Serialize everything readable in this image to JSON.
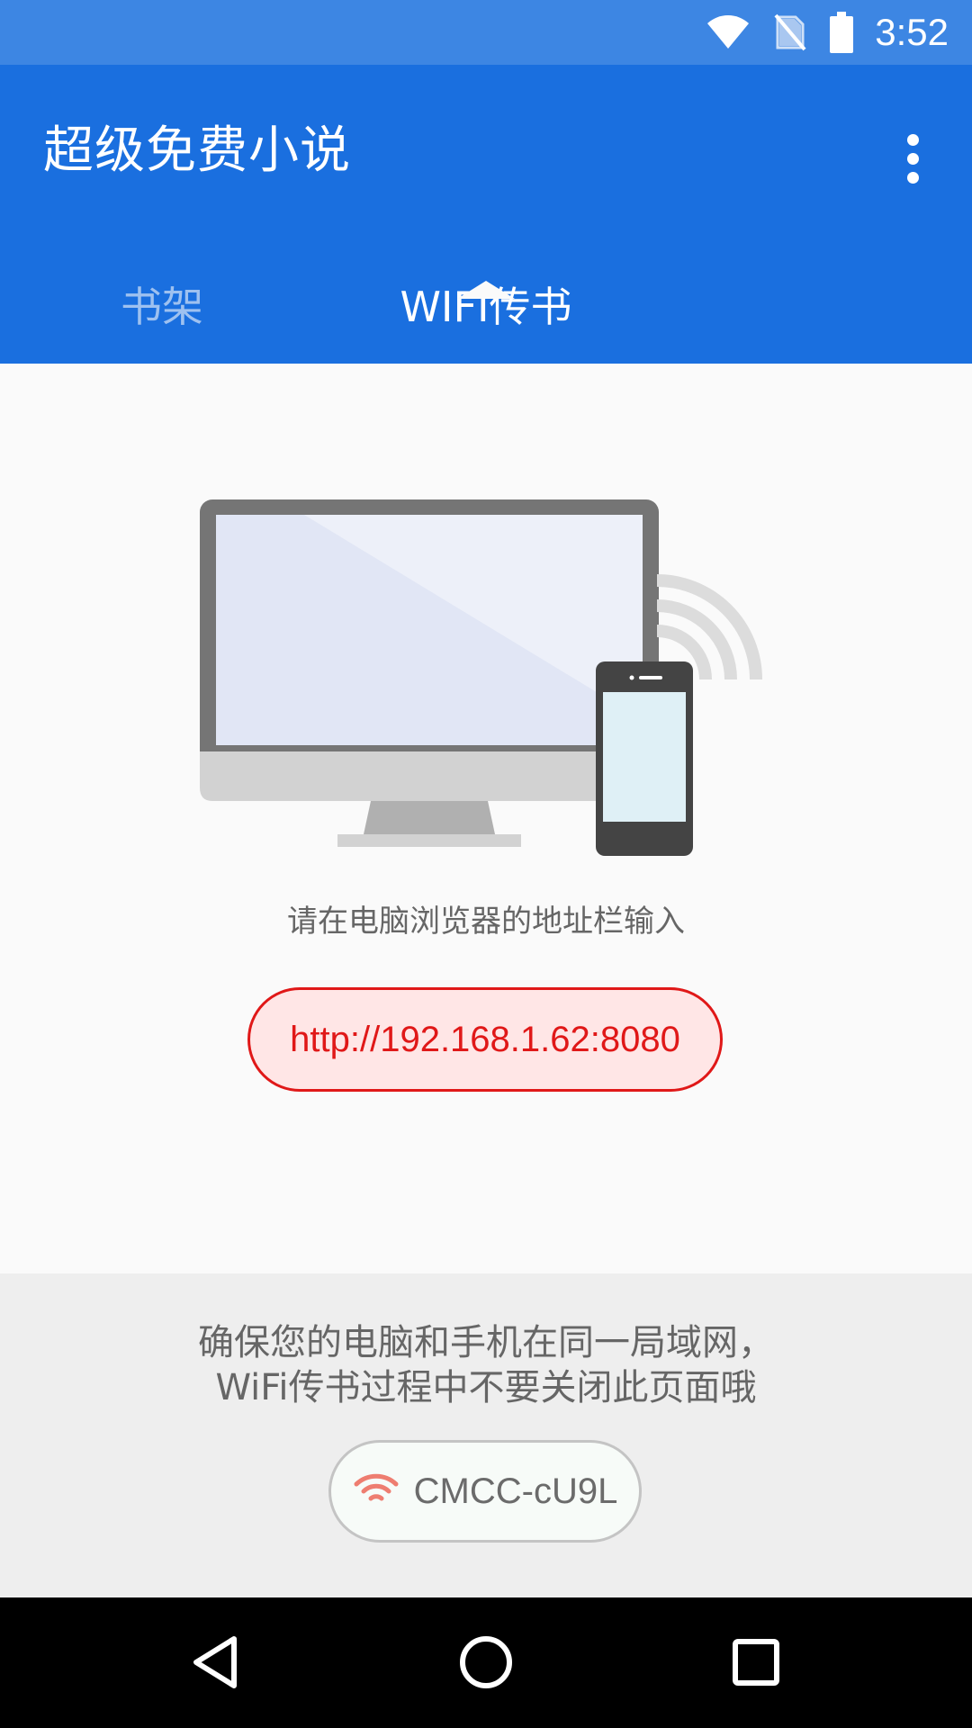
{
  "status_bar": {
    "time": "3:52",
    "icons": [
      "wifi-icon",
      "no-sim-icon",
      "battery-icon"
    ]
  },
  "app_bar": {
    "title": "超级免费小说",
    "overflow_icon": "more-vert-icon"
  },
  "tabs": [
    {
      "label": "书架",
      "selected": false
    },
    {
      "label": "WIFI传书",
      "selected": true
    }
  ],
  "main": {
    "illustration": "computer-phone-wifi-illustration",
    "hint": "请在电脑浏览器的地址栏输入",
    "address": "http://192.168.1.62:8080"
  },
  "info": {
    "line1": "确保您的电脑和手机在同一局域网，",
    "line2": "WiFi传书过程中不要关闭此页面哦",
    "network_icon": "wifi-icon",
    "network_name": "CMCC-cU9L"
  },
  "nav_bar": {
    "buttons": [
      "back-icon",
      "home-icon",
      "recents-icon"
    ]
  },
  "colors": {
    "status_bar": "#3d86e3",
    "app_bar": "#1a6fdf",
    "accent_red": "#e01818",
    "wifi_icon": "#ee7d70"
  }
}
